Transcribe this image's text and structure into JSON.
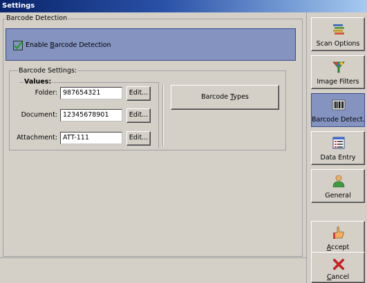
{
  "window": {
    "title": "Settings"
  },
  "detection_group": {
    "legend": "Barcode Detection"
  },
  "enable": {
    "label_pre": "Enable ",
    "label_key": "B",
    "label_post": "arcode Detection",
    "checked": true
  },
  "settings_group": {
    "legend": "Barcode Settings:",
    "values_legend": "Values:",
    "rows": [
      {
        "label": "Folder:",
        "value": "987654321",
        "edit_label": "Edit..."
      },
      {
        "label": "Document:",
        "value": "12345678901",
        "edit_label": "Edit..."
      },
      {
        "label": "Attachment:",
        "value": "ATT-111",
        "edit_label": "Edit..."
      }
    ],
    "types_pre": "Barcode ",
    "types_key": "T",
    "types_post": "ypes"
  },
  "sidebar": {
    "items": [
      {
        "label": "Scan Options",
        "icon": "scan-options-icon"
      },
      {
        "label": "Image Filters",
        "icon": "image-filters-icon"
      },
      {
        "label": "Barcode Detect.",
        "icon": "barcode-icon",
        "active": true
      },
      {
        "label": "Data Entry",
        "icon": "data-entry-icon"
      },
      {
        "label": "General",
        "icon": "general-user-icon"
      }
    ],
    "accept": {
      "key": "A",
      "rest": "ccept",
      "icon": "accept-hand-icon"
    },
    "cancel": {
      "key": "C",
      "rest": "ancel",
      "icon": "cancel-x-icon"
    }
  },
  "colors": {
    "accent": "#8493c0",
    "title_bar": "#0a246a",
    "face": "#d4d0c8"
  }
}
